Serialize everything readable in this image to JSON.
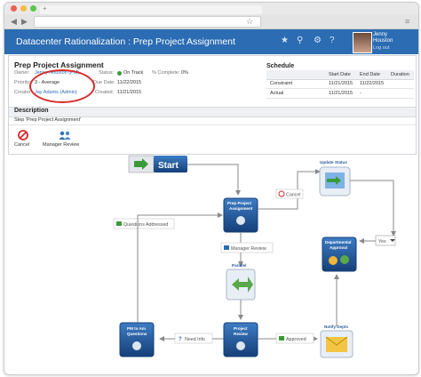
{
  "window": {
    "tab_label": "+"
  },
  "app": {
    "title": "Datacenter Rationalization : Prep Project Assignment"
  },
  "user": {
    "name_first": "Jenny",
    "name_last": "Houston",
    "logout": "Log out"
  },
  "task": {
    "title": "Prep Project Assignment",
    "owner_label": "Owner:",
    "owner_value": "Jenny Houston (PM)",
    "priority_label": "Priority:",
    "priority_value": "3 - Average",
    "creator_label": "Creator:",
    "creator_value": "Jay Adams (Admin)",
    "status_label": "Status:",
    "status_value": "On Track",
    "due_label": "Due Date:",
    "due_value": "11/22/2015",
    "created_label": "Created:",
    "created_value": "11/21/2015",
    "complete_label": "% Complete:",
    "complete_value": "0%"
  },
  "schedule": {
    "title": "Schedule",
    "columns": [
      "Start Date",
      "End Date",
      "Duration"
    ],
    "rows": [
      {
        "label": "Constraint",
        "start": "11/21/2015",
        "end": "11/22/2015",
        "duration": ""
      },
      {
        "label": "Actual",
        "start": "11/21/2015",
        "end": "-",
        "duration": ""
      }
    ]
  },
  "description": {
    "title": "Description",
    "text": "Step 'Prep Project Assignment'"
  },
  "actions": {
    "cancel": "Cancel",
    "manager_review": "Manager Review"
  },
  "workflow": {
    "start": "Start",
    "prep_line1": "Prep Project",
    "prep_line2": "Assignment",
    "update_status": "Update Status",
    "cancel_edge": "Cancel",
    "questions_addressed": "Questions Addressed",
    "manager_review_edge": "Manager Review",
    "parallel": "Parallel",
    "dept_line1": "Departmental",
    "dept_line2": "Approval",
    "yes": "Yes",
    "pm_line1": "PM to Am",
    "pm_line2": "Questions",
    "need_info": "Need Info",
    "project_line1": "Project",
    "project_line2": "Review",
    "approved": "Approved",
    "notify_depts": "Notify Depts"
  },
  "colors": {
    "accent": "#2b6cb3",
    "highlight_ring": "#d62b2b",
    "status_green": "#3a9a3a"
  },
  "icons": [
    "back-arrow-icon",
    "forward-arrow-icon",
    "star-icon",
    "pin-icon",
    "gear-icon",
    "help-icon",
    "cancel-icon",
    "users-icon",
    "arrow-right-icon",
    "envelope-icon"
  ]
}
